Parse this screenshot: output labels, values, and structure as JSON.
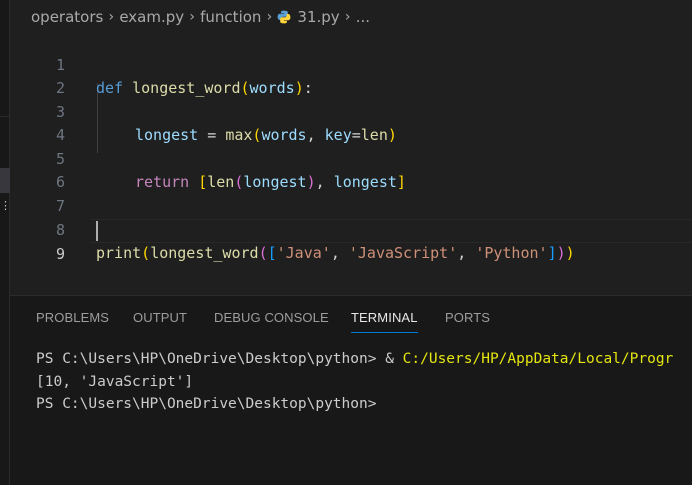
{
  "breadcrumb": {
    "items": [
      "operators",
      "exam.py",
      "function",
      "31.py",
      "..."
    ]
  },
  "editor": {
    "lines": [
      {
        "num": "1"
      },
      {
        "num": "2"
      },
      {
        "num": "3"
      },
      {
        "num": "4"
      },
      {
        "num": "5"
      },
      {
        "num": "6"
      },
      {
        "num": "7"
      },
      {
        "num": "8"
      },
      {
        "num": "9"
      }
    ],
    "code": {
      "l1": {
        "kw": "def",
        "name": "longest_word",
        "p1": "(",
        "arg": "words",
        "p2": ")",
        "colon": ":"
      },
      "l3": {
        "var": "longest",
        "eq": " = ",
        "fn": "max",
        "p1": "(",
        "arg": "words",
        "comma": ", ",
        "key": "key",
        "eq2": "=",
        "fn2": "len",
        "p2": ")"
      },
      "l5": {
        "kw": "return",
        "b1": "[",
        "fn": "len",
        "p1": "(",
        "arg": "longest",
        "p2": ")",
        "comma": ", ",
        "arg2": "longest",
        "b2": "]"
      },
      "l8": {
        "fn": "print",
        "p1": "(",
        "fn2": "longest_word",
        "p2": "(",
        "b": "[",
        "s1": "'Java'",
        "c1": ", ",
        "s2": "'JavaScript'",
        "c2": ", ",
        "s3": "'Python'",
        "bclose": "]",
        "p2close": ")",
        "p1close": ")"
      }
    }
  },
  "panel": {
    "tabs": [
      "PROBLEMS",
      "OUTPUT",
      "DEBUG CONSOLE",
      "TERMINAL",
      "PORTS"
    ],
    "active_tab": "TERMINAL",
    "terminal": {
      "line1_prompt": "PS C:\\Users\\HP\\OneDrive\\Desktop\\python> & ",
      "line1_path": "C:/Users/HP/AppData/Local/Progr",
      "line2": "[10, 'JavaScript']",
      "line3": "PS C:\\Users\\HP\\OneDrive\\Desktop\\python>"
    }
  },
  "colors": {
    "keyword": "#569cd6",
    "control": "#c586c0",
    "function": "#dcdcaa",
    "variable": "#9cdcfe",
    "string": "#ce9178",
    "active_tab_underline": "#0078d4"
  }
}
